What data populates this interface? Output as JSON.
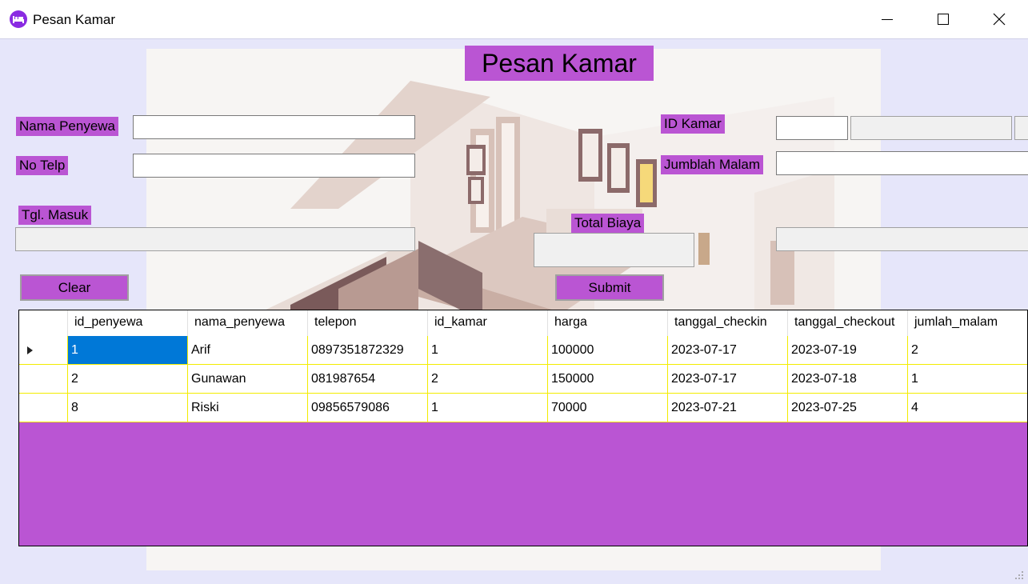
{
  "window": {
    "title": "Pesan Kamar",
    "icon": "bed-icon"
  },
  "form": {
    "heading": "Pesan Kamar",
    "labels": {
      "nama_penyewa": "Nama Penyewa",
      "no_telp": "No Telp",
      "tgl_masuk": "Tgl. Masuk",
      "id_kamar": "ID Kamar",
      "jumlah_malam": "Jumblah Malam",
      "total_biaya": "Total Biaya"
    },
    "values": {
      "nama_penyewa": "",
      "no_telp": "",
      "tgl_masuk": "",
      "id_kamar": "",
      "jumlah_malam": "",
      "total_biaya": ""
    },
    "buttons": {
      "clear": "Clear",
      "submit": "Submit"
    }
  },
  "grid": {
    "columns": [
      "id_penyewa",
      "nama_penyewa",
      "telepon",
      "id_kamar",
      "harga",
      "tanggal_checkin",
      "tanggal_checkout",
      "jumlah_malam"
    ],
    "rows": [
      [
        "1",
        "Arif",
        "0897351872329",
        "1",
        "100000",
        "2023-07-17",
        "2023-07-19",
        "2"
      ],
      [
        "2",
        "Gunawan",
        "081987654",
        "2",
        "150000",
        "2023-07-17",
        "2023-07-18",
        "1"
      ],
      [
        "8",
        "Riski",
        "09856579086",
        "1",
        "70000",
        "2023-07-21",
        "2023-07-25",
        "4"
      ]
    ],
    "current_row_indicator": "triangle-right-icon"
  },
  "colors": {
    "accent": "#ba55d3",
    "client_bg": "#e6e6fa",
    "grid_line": "#f2ec00",
    "selection": "#0078d7"
  }
}
